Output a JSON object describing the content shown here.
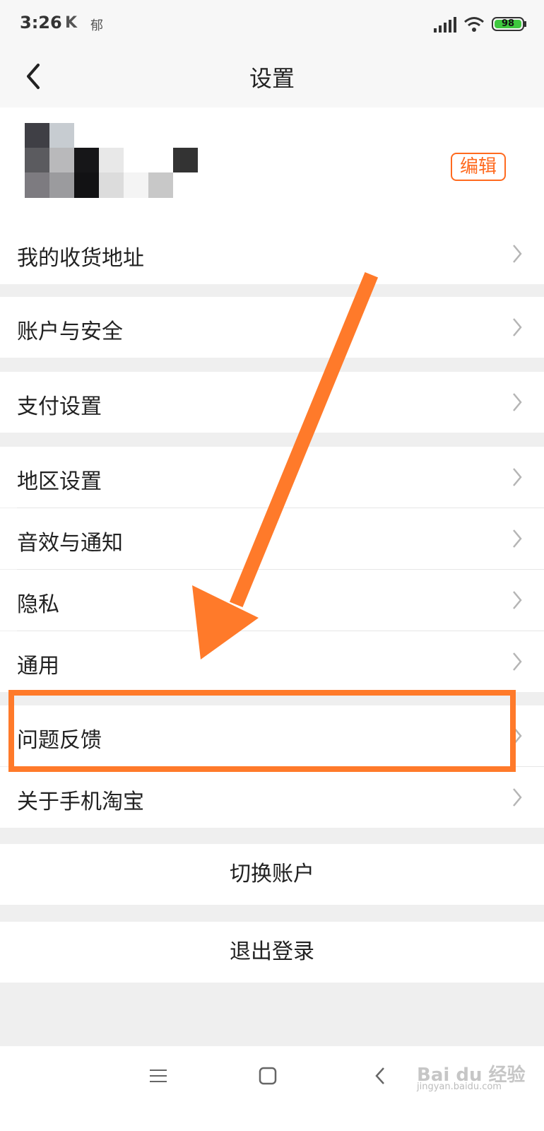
{
  "status_bar": {
    "time": "3:26",
    "k_icon": "K",
    "app_icon_text": "郁",
    "battery_level": "98",
    "signal_icon": "signal-icon",
    "wifi_icon": "wifi-icon"
  },
  "nav": {
    "title": "设置",
    "back_icon": "back-chevron-icon"
  },
  "profile": {
    "edit_label": "编辑"
  },
  "menu": {
    "address": "我的收货地址",
    "account_security": "账户与安全",
    "payment": "支付设置",
    "region": "地区设置",
    "sound_notification": "音效与通知",
    "privacy": "隐私",
    "general": "通用",
    "feedback": "问题反馈",
    "about": "关于手机淘宝"
  },
  "actions": {
    "switch_account": "切换账户",
    "logout": "退出登录"
  },
  "bottom_nav": {
    "menu_icon": "menu-icon",
    "home_icon": "home-square-icon",
    "back_icon": "back-icon"
  },
  "watermark": {
    "text": "Bai du 经验",
    "sub": "jingyan.baidu.com"
  },
  "colors": {
    "accent": "#ff6a1f",
    "annotation": "#ff7a2a",
    "background": "#efefef",
    "battery": "#3ec83e"
  }
}
